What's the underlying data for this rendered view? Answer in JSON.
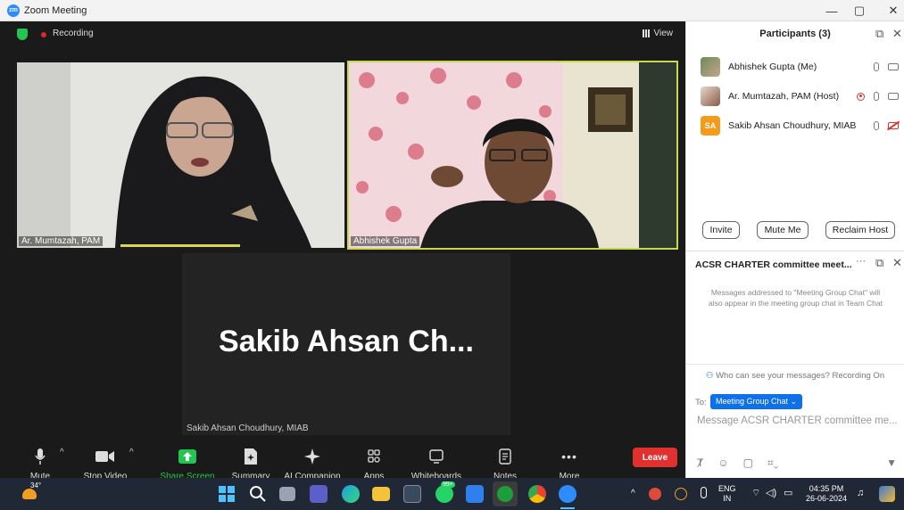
{
  "window": {
    "app_icon_text": "zm",
    "title": "Zoom Meeting",
    "minimize": "—",
    "restore": "▢",
    "close": "✕"
  },
  "meeting": {
    "recording_label": "Recording",
    "view_label": "View",
    "tiles": [
      {
        "label": "Ar. Mumtazah, PAM"
      },
      {
        "label": "Abhishek Gupta"
      },
      {
        "label": "Sakib Ahsan Choudhury, MIAB",
        "display_name": "Sakib Ahsan Ch..."
      }
    ]
  },
  "toolbar": {
    "mute": "Mute",
    "stop_video": "Stop Video",
    "share_screen": "Share Screen",
    "summary": "Summary",
    "ai_companion": "AI Companion",
    "apps": "Apps",
    "whiteboards": "Whiteboards",
    "notes": "Notes",
    "more": "More",
    "leave": "Leave",
    "accent_share": "#23c552",
    "accent_leave": "#e0312f"
  },
  "participants": {
    "header": "Participants (3)",
    "list": [
      {
        "name": "Abhishek Gupta (Me)"
      },
      {
        "name": "Ar. Mumtazah, PAM (Host)"
      },
      {
        "name": "Sakib Ahsan Choudhury, MIAB",
        "initials": "SA"
      }
    ],
    "invite": "Invite",
    "mute_me": "Mute Me",
    "reclaim_host": "Reclaim Host"
  },
  "chat": {
    "title": "ACSR CHARTER committee meet...",
    "note": "Messages addressed to \"Meeting Group Chat\" will also appear in the meeting group chat in Team Chat",
    "who_can_see": "Who can see your messages? Recording On",
    "to_label": "To:",
    "to_value": "Meeting Group Chat ⌄",
    "placeholder": "Message ACSR CHARTER committee me..."
  },
  "taskbar": {
    "temperature": "34°",
    "badge": "99+",
    "lang_top": "ENG",
    "lang_bottom": "IN",
    "time": "04:35 PM",
    "date": "26-06-2024"
  }
}
